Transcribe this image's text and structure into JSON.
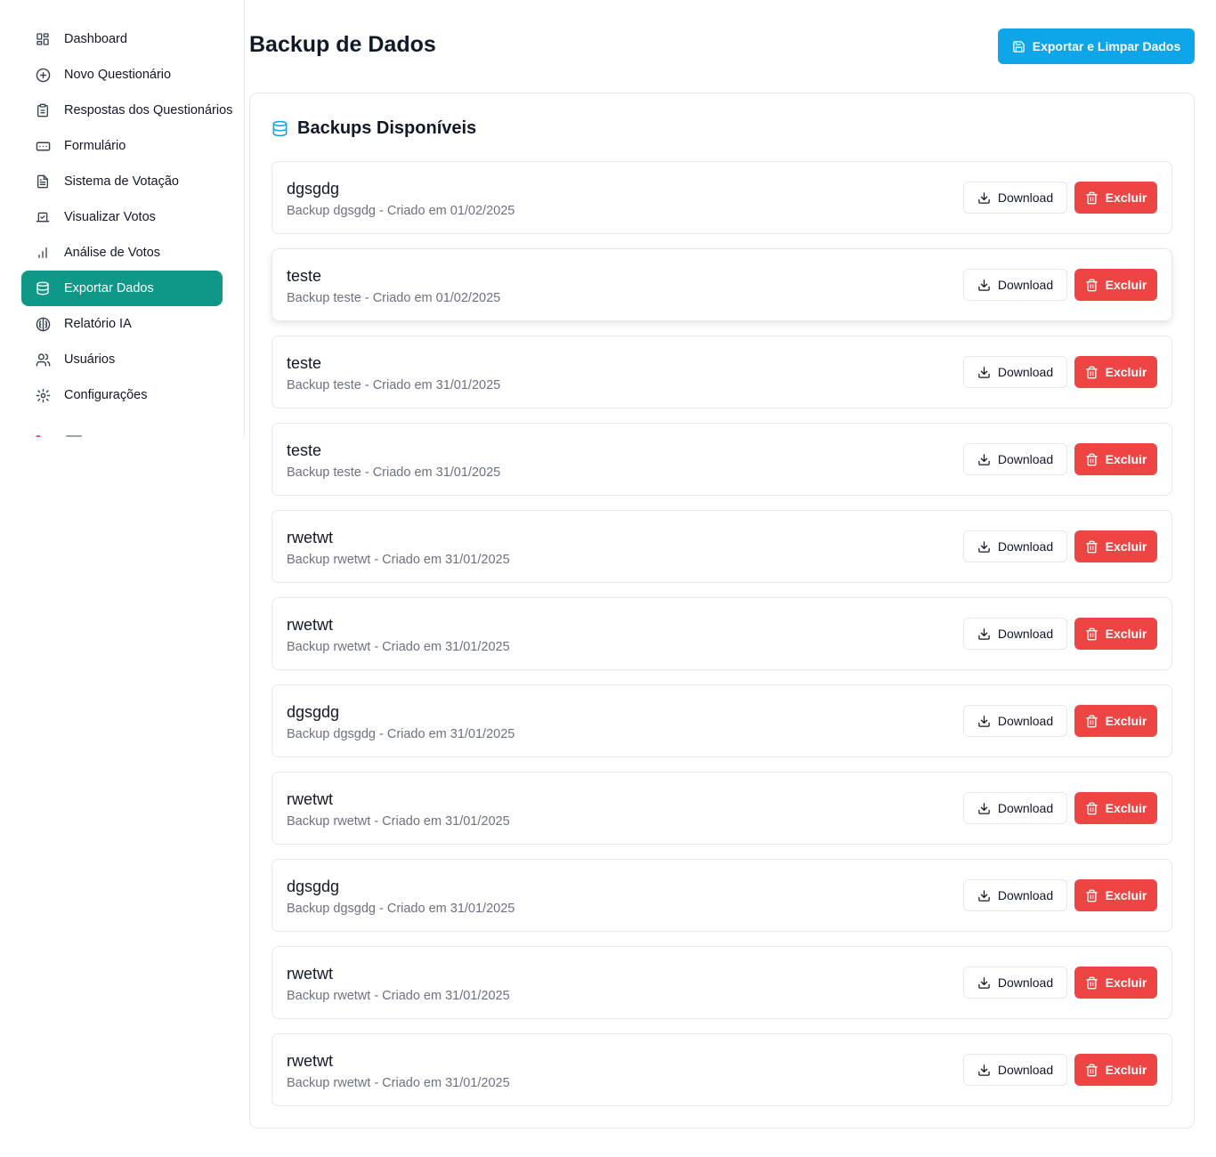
{
  "sidebar": {
    "items": [
      {
        "label": "Dashboard",
        "icon": "layout-grid-icon"
      },
      {
        "label": "Novo Questionário",
        "icon": "plus-circle-icon"
      },
      {
        "label": "Respostas dos Questionários",
        "icon": "clipboard-icon"
      },
      {
        "label": "Formulário",
        "icon": "form-input-icon"
      },
      {
        "label": "Sistema de Votação",
        "icon": "file-text-icon"
      },
      {
        "label": "Visualizar Votos",
        "icon": "vote-icon"
      },
      {
        "label": "Análise de Votos",
        "icon": "bar-chart-icon"
      },
      {
        "label": "Exportar Dados",
        "icon": "database-icon",
        "active": true
      },
      {
        "label": "Relatório IA",
        "icon": "brain-icon"
      },
      {
        "label": "Usuários",
        "icon": "users-icon"
      },
      {
        "label": "Configurações",
        "icon": "settings-icon"
      }
    ]
  },
  "header": {
    "title": "Backup de Dados",
    "export_label": "Exportar e Limpar Dados"
  },
  "backups": {
    "title": "Backups Disponíveis",
    "download_label": "Download",
    "delete_label": "Excluir",
    "items": [
      {
        "name": "dgsgdg",
        "description": "Backup dgsgdg - Criado em 01/02/2025"
      },
      {
        "name": "teste",
        "description": "Backup teste - Criado em 01/02/2025"
      },
      {
        "name": "teste",
        "description": "Backup teste - Criado em 31/01/2025"
      },
      {
        "name": "teste",
        "description": "Backup teste - Criado em 31/01/2025"
      },
      {
        "name": "rwetwt",
        "description": "Backup rwetwt - Criado em 31/01/2025"
      },
      {
        "name": "rwetwt",
        "description": "Backup rwetwt - Criado em 31/01/2025"
      },
      {
        "name": "dgsgdg",
        "description": "Backup dgsgdg - Criado em 31/01/2025"
      },
      {
        "name": "rwetwt",
        "description": "Backup rwetwt - Criado em 31/01/2025"
      },
      {
        "name": "dgsgdg",
        "description": "Backup dgsgdg - Criado em 31/01/2025"
      },
      {
        "name": "rwetwt",
        "description": "Backup rwetwt - Criado em 31/01/2025"
      },
      {
        "name": "rwetwt",
        "description": "Backup rwetwt - Criado em 31/01/2025"
      }
    ]
  },
  "colors": {
    "accent": "#0f9888",
    "primary": "#0ea5e9",
    "danger": "#ef4444"
  }
}
